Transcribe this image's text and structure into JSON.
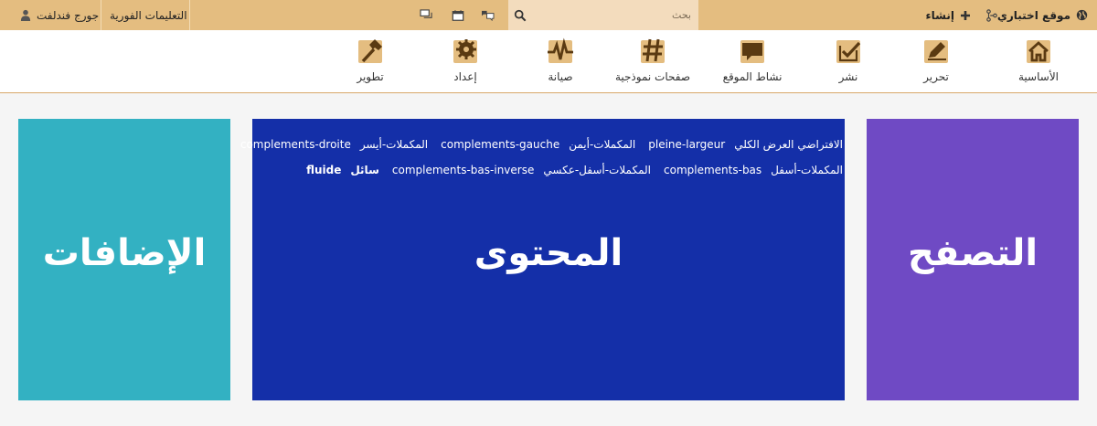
{
  "topbar": {
    "site_name": "موقع اختباري",
    "create_label": "إنشاء",
    "user_name": "جورج فندلفت",
    "instant_help": "التعليمات الفورية",
    "search_placeholder": "بحث"
  },
  "menu": {
    "items": [
      {
        "label": "الأساسية",
        "icon": "home-icon"
      },
      {
        "label": "تحرير",
        "icon": "pencil-icon"
      },
      {
        "label": "نشر",
        "icon": "checkmark-icon"
      },
      {
        "label": "نشاط الموقع",
        "icon": "speech-bubble-icon"
      },
      {
        "label": "صفحات نموذجية",
        "icon": "hash-icon"
      },
      {
        "label": "صيانة",
        "icon": "pulse-icon"
      },
      {
        "label": "إعداد",
        "icon": "gear-icon"
      },
      {
        "label": "تطوير",
        "icon": "hammer-icon"
      }
    ]
  },
  "panels": {
    "navigation_title": "التصفح",
    "content_title": "المحتوى",
    "extras_title": "الإضافات",
    "classes_line1": [
      "الافتراضي العرض الكلي",
      "pleine-largeur",
      "المكملات-أيمن",
      "complements-gauche",
      "المكملات-أيسر",
      "complements-droite"
    ],
    "classes_line2": [
      "المكملات-أسفل",
      "complements-bas",
      "المكملات-أسفل-عكسي",
      "complements-bas-inverse",
      "سائل",
      "fluide"
    ]
  },
  "colors": {
    "topbar": "#e4bd80",
    "search_bg": "#f3dcbd",
    "menu_icon": "#e4bd80",
    "navigation_panel": "#6f4ac4",
    "content_panel": "#142fa8",
    "extras_panel": "#33b1c2"
  }
}
